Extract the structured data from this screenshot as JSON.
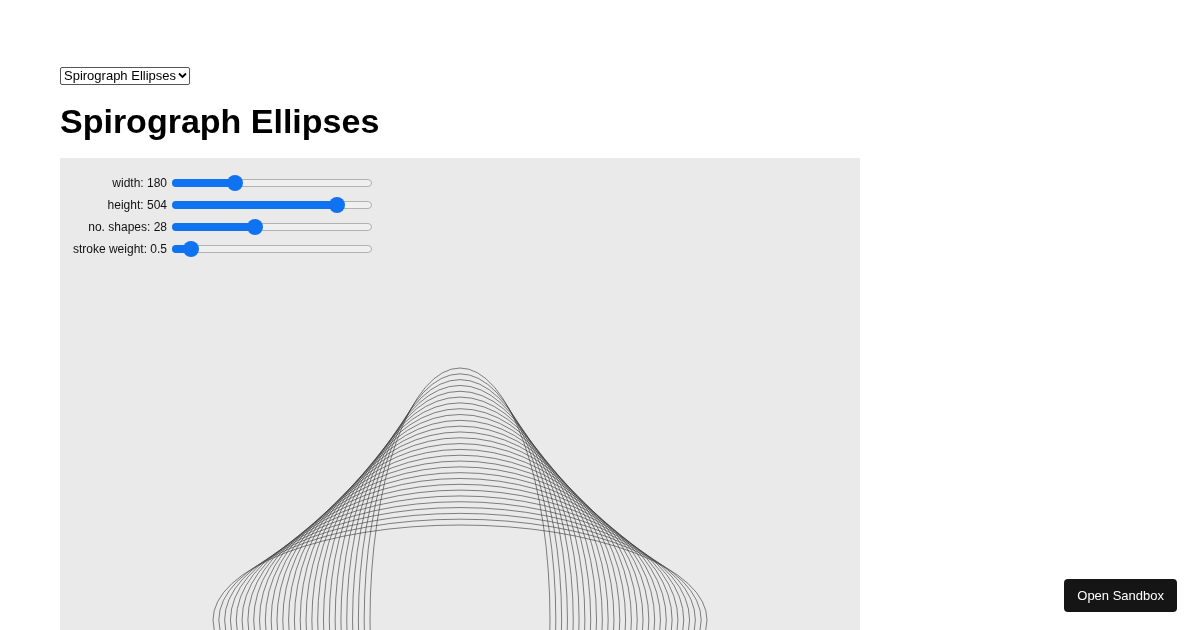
{
  "selector": {
    "value": "Spirograph Ellipses"
  },
  "title": "Spirograph Ellipses",
  "controls": [
    {
      "label": "width: 180",
      "level": 0.31
    },
    {
      "label": "height: 504",
      "level": 0.82
    },
    {
      "label": "no. shapes: 28",
      "level": 0.41
    },
    {
      "label": "stroke weight: 0.5",
      "level": 0.09
    }
  ],
  "sandbox_button": "Open Sandbox"
}
